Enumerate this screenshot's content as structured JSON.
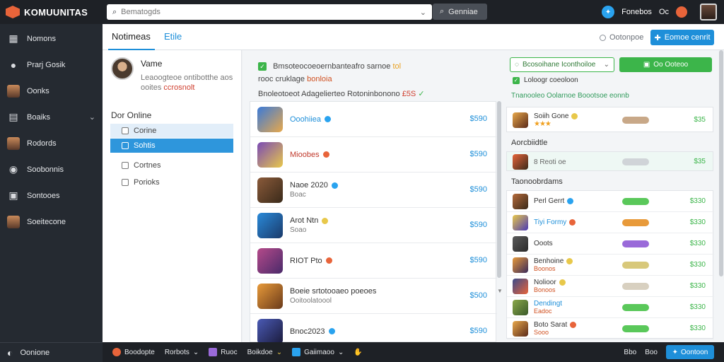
{
  "app": {
    "title": "KOMUUNITAS"
  },
  "search": {
    "placeholder": "Bematogds",
    "button_label": "Genniae"
  },
  "top_right": {
    "label1": "Fonebos",
    "label2": "Oc"
  },
  "sidebar": {
    "items": [
      {
        "label": "Nomons",
        "icon": "grid-icon"
      },
      {
        "label": "Prarj Gosik",
        "icon": "user-icon"
      },
      {
        "label": "Oonks",
        "icon": "avatar"
      },
      {
        "label": "Boaiks",
        "icon": "list-icon"
      },
      {
        "label": "Rodords",
        "icon": "avatar"
      },
      {
        "label": "Soobonnis",
        "icon": "circle-icon"
      },
      {
        "label": "Sontooes",
        "icon": "monitor-icon"
      },
      {
        "label": "Soeitecone",
        "icon": "avatar"
      }
    ],
    "bottom_label": "Oonione"
  },
  "header": {
    "tabs": [
      {
        "label": "Notimeas"
      },
      {
        "label": "Etile"
      }
    ],
    "status": "Ootonpoe",
    "primary_button": "Eomoe cenrit"
  },
  "filter": {
    "profile_name": "Vame",
    "profile_line1": "Leaoogteoe ontibotthe aos",
    "profile_line2_a": "ooites",
    "profile_line2_b": "ccrosnolt",
    "online_label": "Dor Online",
    "options": [
      "Corine",
      "Sohtis",
      "Cortnes",
      "Porioks"
    ]
  },
  "center": {
    "notice_a": "Bmsoteocoeoernbanteafro sarnoe",
    "notice_b": "tol",
    "notice_c": "rooc cruklage",
    "notice_d": "bonloia",
    "sub_a": "Bnoleotoeot Adagelierteo Rotoninbonono",
    "sub_b": "£5S",
    "games": [
      {
        "name": "Ooohiiea",
        "price": "$590",
        "badge": "#2aa3ef",
        "style": "blue",
        "colors": [
          "#3a7ad9",
          "#e8a84a"
        ]
      },
      {
        "name": "Mioobes",
        "price": "$590",
        "badge": "#e8643a",
        "style": "red",
        "colors": [
          "#7a4ab5",
          "#e8c84a"
        ]
      },
      {
        "name": "Naoe 2020",
        "meta": "Boac",
        "price": "$590",
        "badge": "#2aa3ef",
        "style": "",
        "colors": [
          "#8a5a3a",
          "#3a2a1a"
        ]
      },
      {
        "name": "Arot Ntn",
        "meta": "Soao",
        "price": "$590",
        "badge": "#e8c84a",
        "style": "",
        "colors": [
          "#2a8ad9",
          "#1a3a6a"
        ]
      },
      {
        "name": "RIOT Pto",
        "price": "$590",
        "badge": "#e8643a",
        "style": "",
        "colors": [
          "#b54a8a",
          "#4a2a6a"
        ]
      },
      {
        "name": "Boeie srtotooaeo poeoes",
        "meta": "Ooitoolatoool",
        "price": "$500",
        "badge": "",
        "style": "",
        "colors": [
          "#e89a3a",
          "#6a3a1a"
        ]
      },
      {
        "name": "Bnoc2023",
        "price": "$590",
        "badge": "#2aa3ef",
        "style": "",
        "colors": [
          "#4a5ab5",
          "#1a1a3a"
        ]
      }
    ]
  },
  "right": {
    "select_label": "Bcosoihane Iconthoiloe",
    "green_button": "Oo Ooteoo",
    "check_label": "Loloogr coeoloon",
    "sub_label": "Tnanooleo Oolarnoe Boootsoe eonnb",
    "top_card": {
      "name": "Soiih Gone",
      "price": "$35",
      "pill_color": "#c8a888",
      "stars": "★★★"
    },
    "section1_title": "Aorcbiidtle",
    "section1_row": {
      "meta": "8 Reoti oe",
      "price": "$35",
      "pill_color": "#d0d4d8"
    },
    "section2_title": "Taonoobrdams",
    "rows": [
      {
        "name": "Perl Gerrt",
        "price": "$330",
        "pill_color": "#5ac85a",
        "badge": "#2aa3ef",
        "colors": [
          "#b56a3a",
          "#3a2a1a"
        ]
      },
      {
        "name": "Tiyi Formy",
        "price": "$330",
        "pill_color": "#e89a3a",
        "badge": "#e8643a",
        "style": "blue",
        "colors": [
          "#e8c84a",
          "#4a3ab5"
        ]
      },
      {
        "name": "Ooots",
        "price": "$330",
        "pill_color": "#9a6ad9",
        "badge": "",
        "colors": [
          "#5a5a5a",
          "#2a2a2a"
        ]
      },
      {
        "name": "Benhoine",
        "meta": "Boonos",
        "price": "$330",
        "pill_color": "#d8c87a",
        "badge": "#e8c84a",
        "colors": [
          "#e89a3a",
          "#3a2a5a"
        ]
      },
      {
        "name": "Nolioor",
        "meta": "Bonoos",
        "price": "$330",
        "pill_color": "#d8d0c0",
        "badge": "#e8c84a",
        "colors": [
          "#3a4a8a",
          "#e8643a"
        ]
      },
      {
        "name": "Dendingt",
        "meta": "Eadoc",
        "price": "$330",
        "pill_color": "#5ac85a",
        "badge": "",
        "style": "blue",
        "colors": [
          "#8aa84a",
          "#3a5a2a"
        ]
      },
      {
        "name": "Boto Sarat",
        "meta": "Sooo",
        "price": "$330",
        "pill_color": "#5ac85a",
        "badge": "#e8643a",
        "colors": [
          "#e8a84a",
          "#5a2a1a"
        ]
      }
    ]
  },
  "bottom": {
    "items": [
      "Boodopte",
      "Rorbots",
      "Ruoc",
      "Boikdoe",
      "Gaiimaoo"
    ],
    "right_a": "Bbo",
    "right_b": "Boo",
    "button": "Oontoon"
  }
}
